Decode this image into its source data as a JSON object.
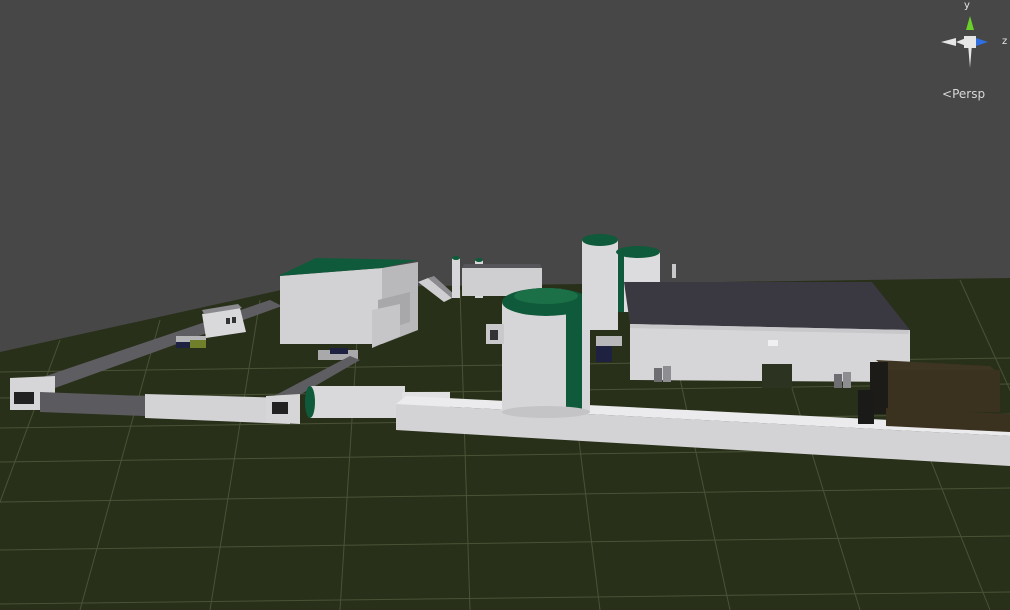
{
  "viewport": {
    "projection_label": "Persp",
    "projection_prefix": "<",
    "gizmo": {
      "axis_y": "y",
      "axis_z": "z"
    }
  },
  "colors": {
    "sky": "#474747",
    "ground": "#28301a",
    "grid": "#4a5236",
    "building_wall": "#d6d6d8",
    "building_roof": "#3a3840",
    "green_roof": "#0f5a3a",
    "gizmo_y": "#6bd12a",
    "gizmo_z": "#2f6fe0"
  }
}
